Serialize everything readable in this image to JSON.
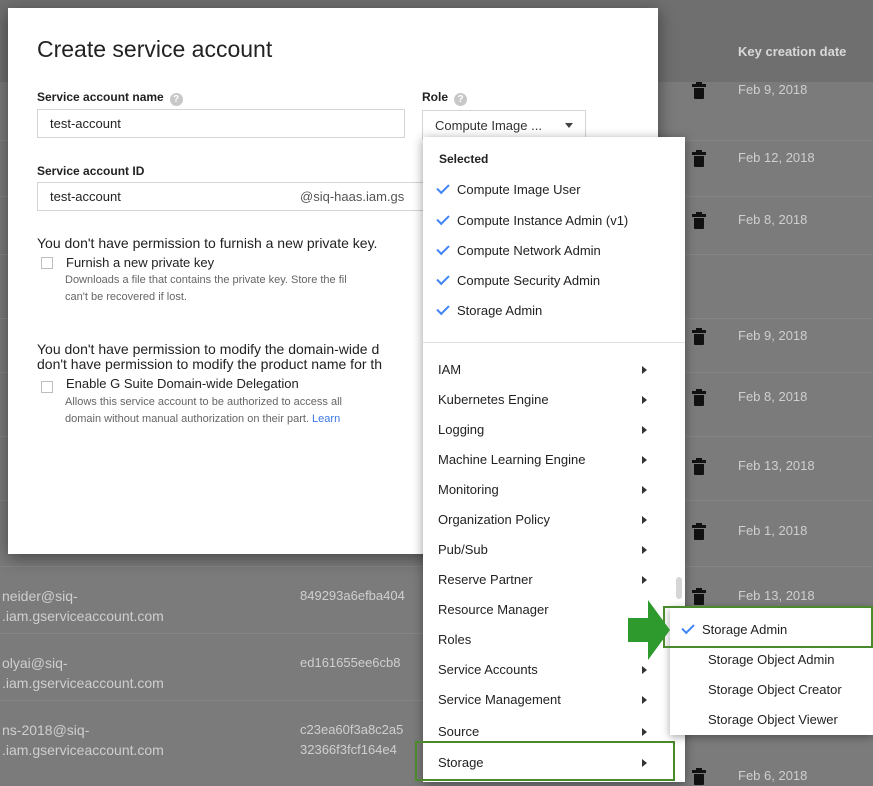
{
  "background_table": {
    "header_date_label": "Key creation date",
    "dates": [
      "Feb 9, 2018",
      "Feb 12, 2018",
      "Feb 8, 2018",
      "Feb 9, 2018",
      "Feb 8, 2018",
      "Feb 13, 2018",
      "Feb 1, 2018",
      "Feb 13, 2018",
      "Feb 6, 2018"
    ],
    "rows": [
      {
        "email_line1": "neider@siq-",
        "email_line2": ".iam.gserviceaccount.com",
        "key_line1": "849293a6efba404",
        "key_line2": ""
      },
      {
        "email_line1": "olyai@siq-",
        "email_line2": ".iam.gserviceaccount.com",
        "key_line1": "ed161655ee6cb8",
        "key_line2": ""
      },
      {
        "email_line1": "ns-2018@siq-",
        "email_line2": ".iam.gserviceaccount.com",
        "key_line1": "c23ea60f3a8c2a5",
        "key_line2": "32366f3fcf164e4"
      }
    ]
  },
  "dialog": {
    "title": "Create service account",
    "name_label": "Service account name",
    "name_help": "?",
    "name_value": "test-account",
    "role_label": "Role",
    "role_help": "?",
    "role_value": "Compute Image ...",
    "id_label": "Service account ID",
    "id_value": "test-account",
    "id_suffix": "@siq-haas.iam.gs",
    "key_permission_text": "You don't have permission to furnish a new private key.",
    "key_checkbox_label": "Furnish a new private key",
    "key_hint_line1": "Downloads a file that contains the private key. Store the fil",
    "key_hint_line2": "can't be recovered if lost.",
    "domain_permission_line1": "You don't have permission to modify the domain-wide d",
    "domain_permission_line2": "don't have permission to modify the product name for th",
    "domain_checkbox_label": "Enable G Suite Domain-wide Delegation",
    "domain_hint_line1": "Allows this service account to be authorized to access all",
    "domain_hint_line2": "domain without manual authorization on their part.",
    "domain_hint_link": "Learn"
  },
  "role_menu": {
    "selected_header": "Selected",
    "selected_items": [
      "Compute Image User",
      "Compute Instance Admin (v1)",
      "Compute Network Admin",
      "Compute Security Admin",
      "Storage Admin"
    ],
    "categories": [
      "IAM",
      "Kubernetes Engine",
      "Logging",
      "Machine Learning Engine",
      "Monitoring",
      "Organization Policy",
      "Pub/Sub",
      "Reserve Partner",
      "Resource Manager",
      "Roles",
      "Service Accounts",
      "Service Management",
      "Source",
      "Storage"
    ],
    "highlighted_category": "Storage"
  },
  "storage_submenu": {
    "items": [
      "Storage Admin",
      "Storage Object Admin",
      "Storage Object Creator",
      "Storage Object Viewer"
    ],
    "checked_item": "Storage Admin"
  },
  "colors": {
    "check_blue": "#4285f4",
    "highlight_green": "#4a8a2c",
    "arrow_green": "#2e9a2e",
    "link_blue": "#3b78e7"
  }
}
